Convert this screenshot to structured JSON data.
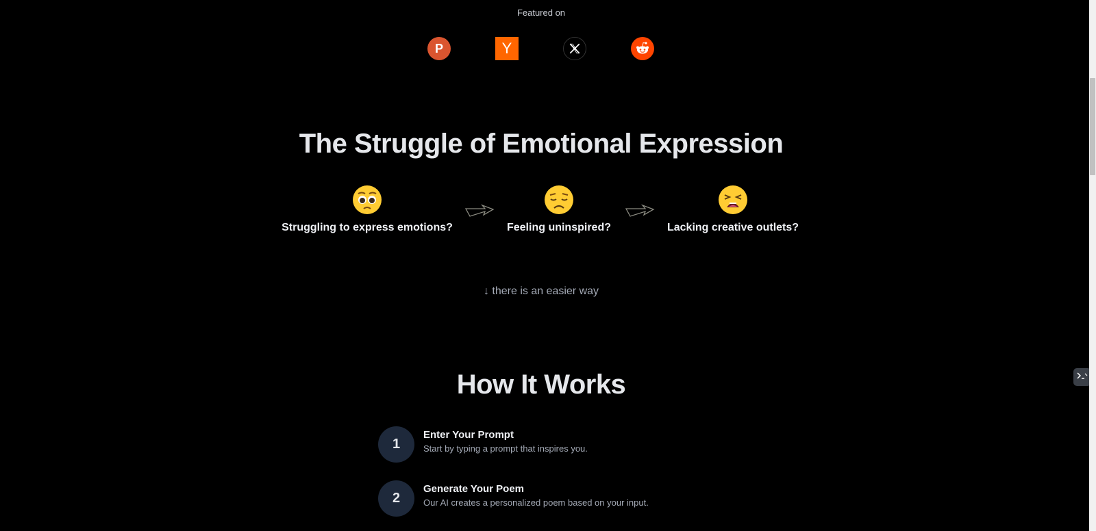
{
  "featured": {
    "label": "Featured on",
    "sites": [
      {
        "name": "product-hunt",
        "glyph": "P",
        "color": "#da552f"
      },
      {
        "name": "hacker-news",
        "glyph": "Y",
        "color": "#ff6600"
      },
      {
        "name": "x",
        "glyph": "X",
        "color": "#000000"
      },
      {
        "name": "reddit",
        "glyph": "",
        "color": "#ff4500"
      }
    ]
  },
  "struggle": {
    "title": "The Struggle of Emotional Expression",
    "steps": [
      {
        "icon": "pleading-face-icon",
        "text": "Struggling to express emotions?"
      },
      {
        "icon": "disappointed-face-icon",
        "text": "Feeling uninspired?"
      },
      {
        "icon": "weary-face-icon",
        "text": "Lacking creative outlets?"
      }
    ],
    "easier_link": "↓ there is an easier way"
  },
  "how_it_works": {
    "title": "How It Works",
    "steps": [
      {
        "number": "1",
        "title": "Enter Your Prompt",
        "description": "Start by typing a prompt that inspires you."
      },
      {
        "number": "2",
        "title": "Generate Your Poem",
        "description": "Our AI creates a personalized poem based on your input."
      }
    ]
  },
  "colors": {
    "background": "#000000",
    "step_circle": "#1e293b",
    "heading": "#e5e7eb",
    "muted": "#a3a9b5"
  }
}
